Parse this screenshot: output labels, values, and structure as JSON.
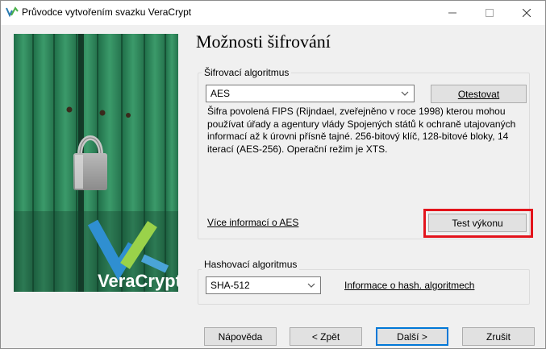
{
  "window": {
    "title": "Průvodce vytvořením svazku VeraCrypt",
    "minimize_icon": "minimize-icon",
    "maximize_icon": "maximize-icon",
    "close_icon": "close-icon"
  },
  "side_image": {
    "brand_name": "VeraCrypt"
  },
  "page": {
    "title": "Možnosti šifrování"
  },
  "encryption": {
    "group_label": "Šifrovací algoritmus",
    "selected": "AES",
    "test_button": "Otestovat",
    "description": "Šifra povolená FIPS (Rijndael, zveřejněno v roce 1998) kterou mohou používat úřady a agentury vlády Spojených států k ochraně utajovaných informací až k úrovni přísně tajné. 256-bitový klíč, 128-bitové  bloky, 14 iterací (AES-256). Operační režim je XTS.",
    "more_info_link": "Více informací o AES",
    "benchmark_button": "Test výkonu"
  },
  "hash": {
    "group_label": "Hashovací algoritmus",
    "selected": "SHA-512",
    "info_link": "Informace o hash. algoritmech"
  },
  "footer": {
    "help_button": "Nápověda",
    "back_button": "< Zpět",
    "next_button": "Další >",
    "cancel_button": "Zrušit"
  },
  "colors": {
    "highlight": "#e3141c",
    "default_button_border": "#0078d7",
    "image_green": "#2e8a5e"
  }
}
